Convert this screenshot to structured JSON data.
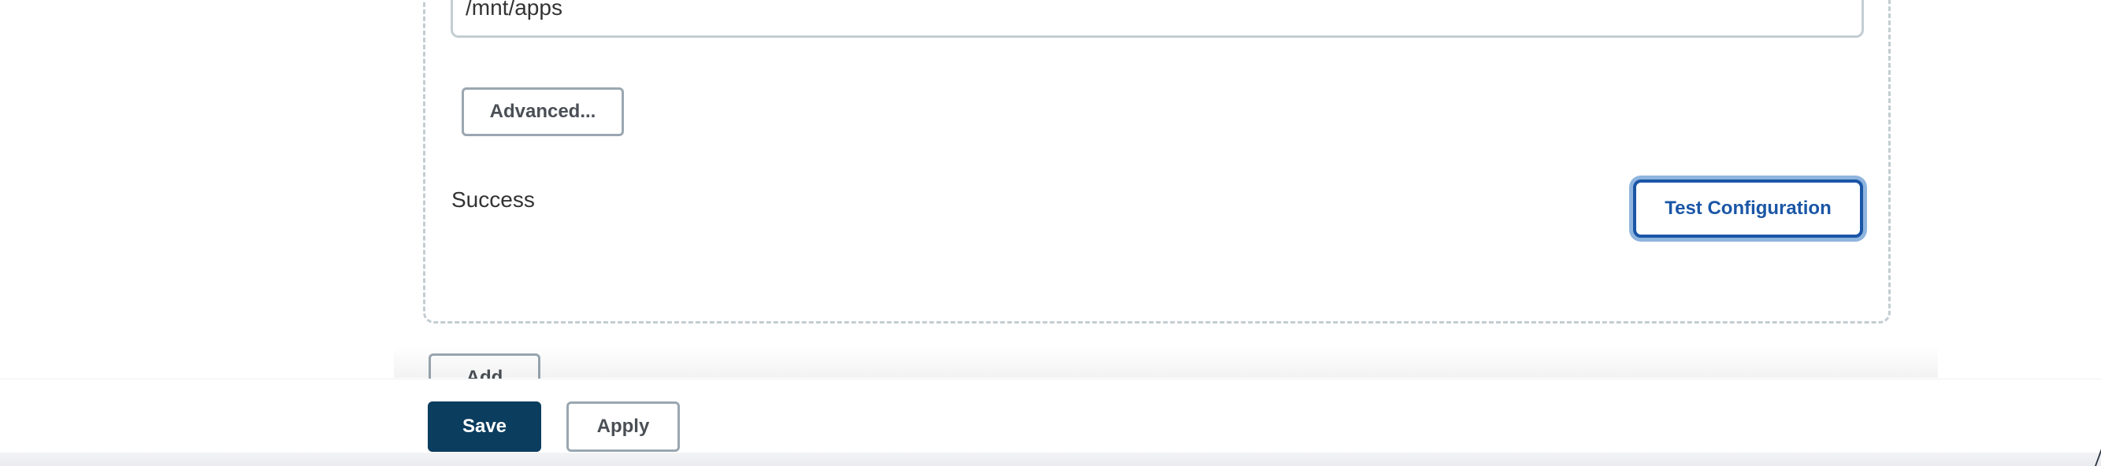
{
  "config": {
    "path_value": "/mnt/apps",
    "advanced_label": "Advanced...",
    "status_text": "Success",
    "test_config_label": "Test Configuration"
  },
  "actions": {
    "add_label": "Add",
    "save_label": "Save",
    "apply_label": "Apply"
  },
  "colors": {
    "primary": "#0b3d5e",
    "link_blue": "#1a56a6",
    "border_gray": "#9aa7b1",
    "panel_border": "#c3cdd2"
  }
}
